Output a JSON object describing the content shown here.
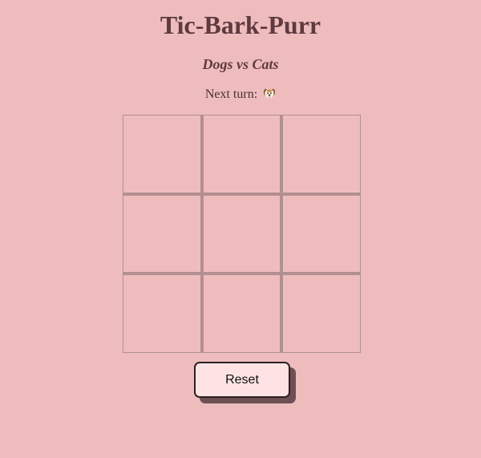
{
  "header": {
    "title": "Tic-Bark-Purr",
    "subtitle": "Dogs vs Cats"
  },
  "status": {
    "next_turn_label": "Next turn:",
    "next_player_icon": "dog-face-icon"
  },
  "board": {
    "cells": [
      "",
      "",
      "",
      "",
      "",
      "",
      "",
      "",
      ""
    ]
  },
  "controls": {
    "reset_label": "Reset"
  },
  "colors": {
    "background": "#efbcbe",
    "title_text": "#5e3a3e",
    "grid_line": "#b28f90",
    "button_face": "#fde3e3",
    "button_shadow": "#6d5054"
  }
}
